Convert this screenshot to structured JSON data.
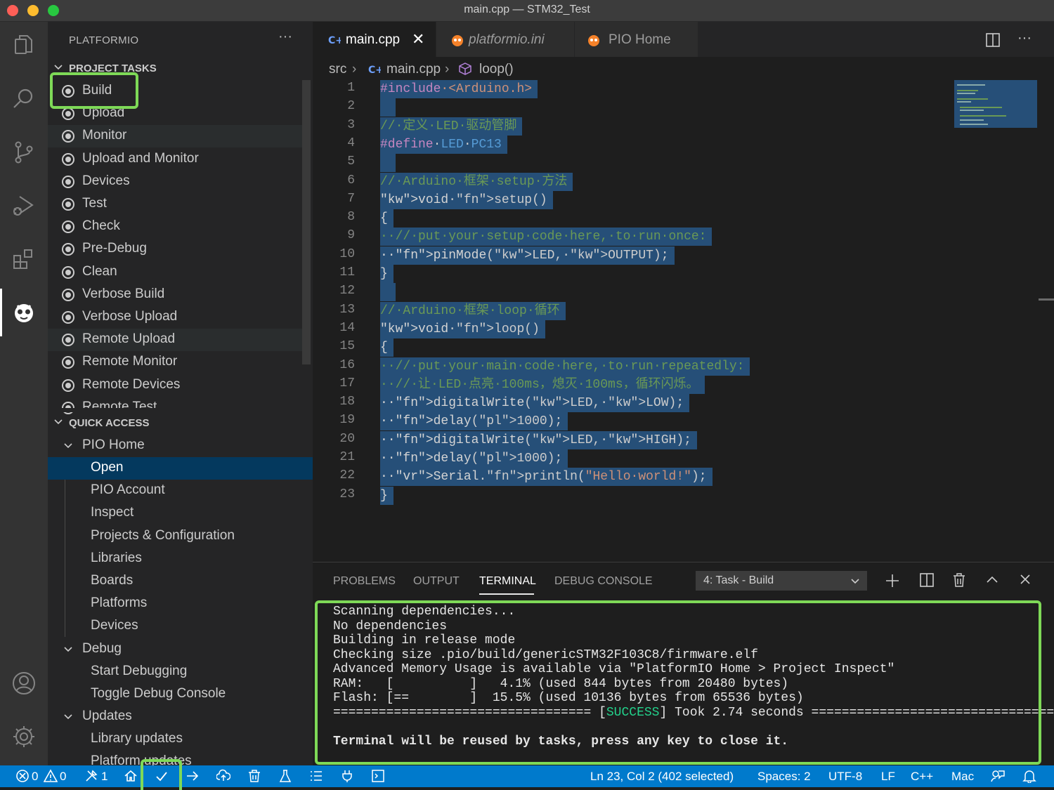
{
  "window": {
    "title": "main.cpp — STM32_Test"
  },
  "activity_bar": {
    "icons": [
      "explorer-icon",
      "search-icon",
      "source-control-icon",
      "run-debug-icon",
      "extensions-icon",
      "platformio-icon",
      "account-icon",
      "gear-icon"
    ]
  },
  "sidebar": {
    "title": "PLATFORMIO",
    "more": "···",
    "project_tasks": {
      "header": "PROJECT TASKS",
      "items": [
        "Build",
        "Upload",
        "Monitor",
        "Upload and Monitor",
        "Devices",
        "Test",
        "Check",
        "Pre-Debug",
        "Clean",
        "Verbose Build",
        "Verbose Upload",
        "Remote Upload",
        "Remote Monitor",
        "Remote Devices",
        "Remote Test"
      ]
    },
    "quick_access": {
      "header": "QUICK ACCESS",
      "pio_home": "PIO Home",
      "pio_home_items": [
        "Open",
        "PIO Account",
        "Inspect",
        "Projects & Configuration",
        "Libraries",
        "Boards",
        "Platforms",
        "Devices"
      ],
      "debug": "Debug",
      "debug_items": [
        "Start Debugging",
        "Toggle Debug Console"
      ],
      "updates": "Updates",
      "updates_items": [
        "Library updates",
        "Platform updates"
      ]
    }
  },
  "editor": {
    "tabs": [
      {
        "label": "main.cpp",
        "active": true
      },
      {
        "label": "platformio.ini",
        "active": false
      },
      {
        "label": "PIO Home",
        "active": false
      }
    ],
    "breadcrumb": {
      "folder": "src",
      "file": "main.cpp",
      "symbol": "loop()"
    },
    "code_lines": [
      "#include <Arduino.h>",
      "",
      "// 定义 LED 驱动管脚",
      "#define LED PC13",
      "",
      "// Arduino 框架 setup 方法",
      "void setup()",
      "{",
      "  // put your setup code here, to run once:",
      "  pinMode(LED, OUTPUT);",
      "}",
      "",
      "// Arduino 框架 loop 循环",
      "void loop()",
      "{",
      "  // put your main code here, to run repeatedly:",
      "  // 让 LED 点亮 100ms，熄灭 100ms，循环闪烁。",
      "  digitalWrite(LED, LOW);",
      "  delay(1000);",
      "  digitalWrite(LED, HIGH);",
      "  delay(1000);",
      "  Serial.println(\"Hello world!\");",
      "}"
    ]
  },
  "panel": {
    "tabs": [
      "PROBLEMS",
      "OUTPUT",
      "TERMINAL",
      "DEBUG CONSOLE"
    ],
    "active_tab": "TERMINAL",
    "terminal_select": "4: Task - Build",
    "terminal_lines": [
      "Scanning dependencies...",
      "No dependencies",
      "Building in release mode",
      "Checking size .pio/build/genericSTM32F103C8/firmware.elf",
      "Advanced Memory Usage is available via \"PlatformIO Home > Project Inspect\"",
      "RAM:   [          ]   4.1% (used 844 bytes from 20480 bytes)",
      "Flash: [==        ]  15.5% (used 10136 bytes from 65536 bytes)",
      "",
      "",
      "Terminal will be reused by tasks, press any key to close it."
    ],
    "success_line": {
      "left_rule": "==================================",
      "open_bracket": " [",
      "success": "SUCCESS",
      "rest": "] Took 2.74 seconds ",
      "right_rule": "==================================="
    }
  },
  "status_bar": {
    "errors": "0",
    "warnings": "0",
    "tools": "1",
    "position": "Ln 23, Col 2 (402 selected)",
    "spaces": "Spaces: 2",
    "encoding": "UTF-8",
    "eol": "LF",
    "language": "C++",
    "platform": "Mac"
  },
  "colors": {
    "accent": "#007acc",
    "highlight": "#7ed957",
    "selection": "#264f78"
  }
}
